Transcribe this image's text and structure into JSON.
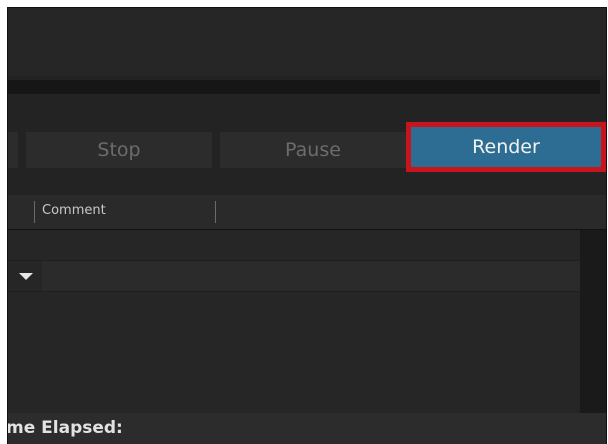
{
  "render_queue": {
    "progress_fraction": 0.0,
    "buttons": {
      "stop_label": "Stop",
      "pause_label": "Pause",
      "render_label": "Render"
    },
    "columns": {
      "comment_label": "Comment"
    },
    "status": {
      "elapsed_label": "me Elapsed:"
    }
  },
  "colors": {
    "accent": "#2d6d94",
    "highlight_border": "#c8141c",
    "background": "#232323"
  },
  "icons": {
    "expand": "triangle-down-icon"
  }
}
